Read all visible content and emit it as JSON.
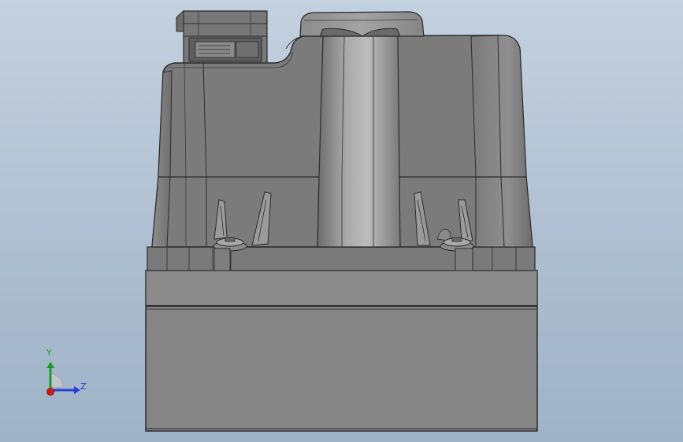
{
  "viewport": {
    "background_top": "#c4d1df",
    "background_bottom": "#9fb2c7"
  },
  "model": {
    "body_color": "#7c7c7c",
    "highlight_color": "#b5b5b5",
    "edge_color": "#2b2b2b"
  },
  "triad": {
    "y_label": "Y",
    "z_label": "Z",
    "y_color": "#1f9a2a",
    "z_color": "#2a3fd0",
    "x_color": "#d01a1a"
  }
}
